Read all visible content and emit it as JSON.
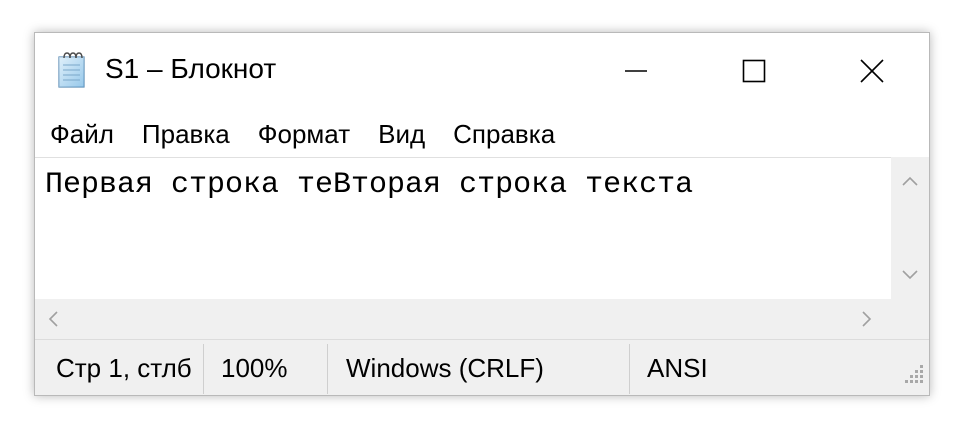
{
  "window": {
    "title": "S1 – Блокнот",
    "icon": "notepad-icon",
    "controls": [
      "minimize-icon",
      "maximize-icon",
      "close-icon"
    ]
  },
  "menu": {
    "items": [
      "Файл",
      "Правка",
      "Формат",
      "Вид",
      "Справка"
    ]
  },
  "editor": {
    "content": "Первая строка теВторая строка текста"
  },
  "status": {
    "position": "Стр 1, стлб",
    "zoom": "100%",
    "line_endings": "Windows (CRLF)",
    "encoding": "ANSI"
  },
  "colors": {
    "chrome": "#f0f0f0",
    "text": "#000000",
    "arrow": "#a0a0a0"
  }
}
